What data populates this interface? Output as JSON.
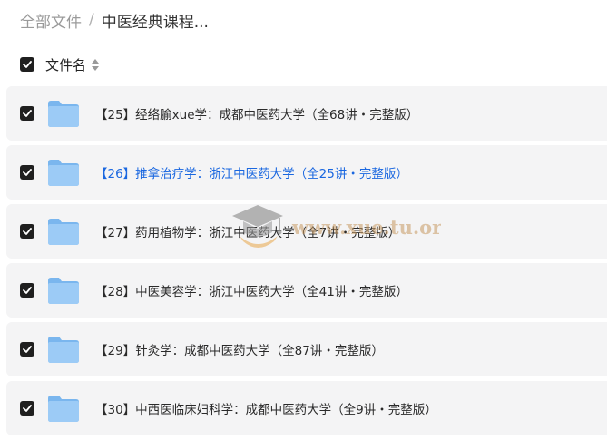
{
  "breadcrumb": {
    "root": "全部文件",
    "separator": "/",
    "current": "中医经典课程..."
  },
  "list_header": {
    "column_label": "文件名"
  },
  "files": [
    {
      "name": "【25】经络腧xue学：成都中医药大学（全68讲・完整版）",
      "active": false
    },
    {
      "name": "【26】推拿治疗学：浙江中医药大学（全25讲・完整版）",
      "active": true
    },
    {
      "name": "【27】药用植物学：浙江中医药大学（全7讲・完整版）",
      "active": false
    },
    {
      "name": "【28】中医美容学：浙江中医药大学（全41讲・完整版）",
      "active": false
    },
    {
      "name": "【29】针灸学：成都中医药大学（全87讲・完整版）",
      "active": false
    },
    {
      "name": "【30】中西医临床妇科学：成都中医药大学（全9讲・完整版）",
      "active": false
    }
  ],
  "watermark": {
    "text": "www.xue.tu.org"
  },
  "colors": {
    "accent": "#1a67e0",
    "row_bg": "#f4f4f5",
    "folder": "#8fc4f5"
  }
}
